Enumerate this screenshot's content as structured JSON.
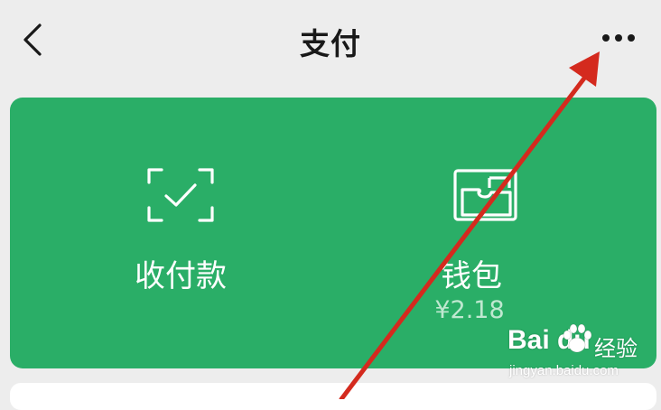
{
  "nav": {
    "title": "支付",
    "back_icon": "chevron-left-icon",
    "more_icon": "more-horizontal-icon"
  },
  "card": {
    "color": "#2aae67",
    "actions": [
      {
        "label": "收付款",
        "icon": "scan-check-icon"
      },
      {
        "label": "钱包",
        "sub": "¥2.18",
        "icon": "wallet-icon"
      }
    ]
  },
  "annotation": {
    "arrow_color": "#d42a1e"
  },
  "watermark": {
    "logo": "Bai du",
    "name": "经验",
    "url": "jingyan.baidu.com"
  }
}
